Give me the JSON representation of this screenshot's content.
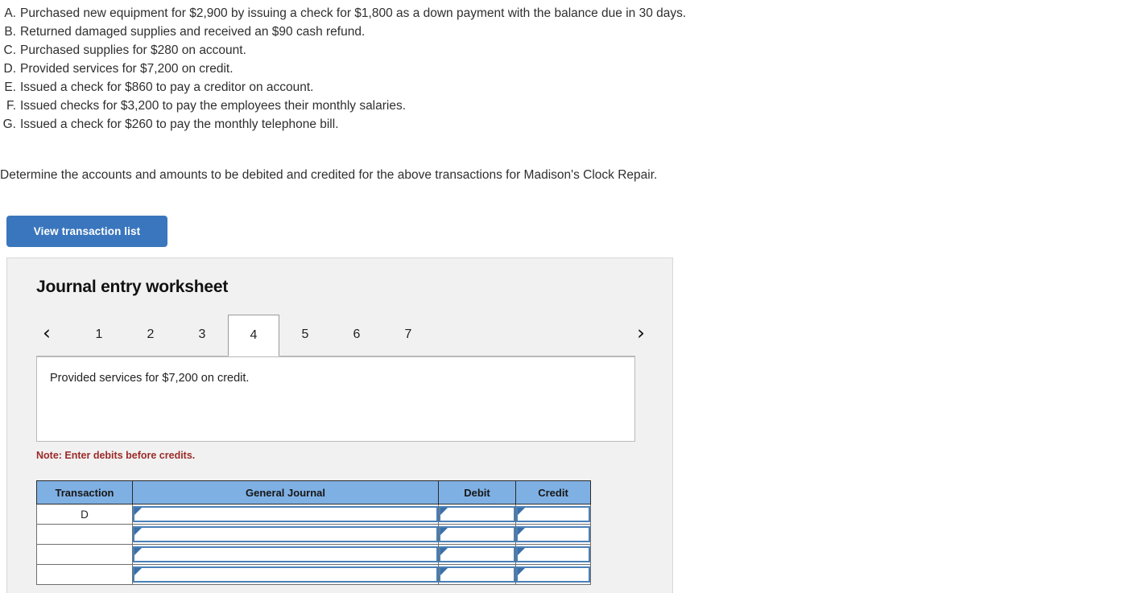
{
  "transactions": [
    {
      "letter": "A.",
      "text": "Purchased new equipment for $2,900 by issuing a check for $1,800 as a down payment with the balance due in 30 days."
    },
    {
      "letter": "B.",
      "text": "Returned damaged supplies and received an $90 cash refund."
    },
    {
      "letter": "C.",
      "text": "Purchased supplies for $280 on account."
    },
    {
      "letter": "D.",
      "text": "Provided services for $7,200 on credit."
    },
    {
      "letter": "E.",
      "text": "Issued a check for $860 to pay a creditor on account."
    },
    {
      "letter": "F.",
      "text": "Issued checks for $3,200 to pay the employees their monthly salaries."
    },
    {
      "letter": "G.",
      "text": "Issued a check for $260 to pay the monthly telephone bill."
    }
  ],
  "prompt": "Determine the accounts and amounts to be debited and credited for the above transactions for Madison's Clock Repair.",
  "view_button_label": "View transaction list",
  "worksheet": {
    "title": "Journal entry worksheet",
    "prev_arrow": "‹",
    "next_arrow": "›",
    "tabs": [
      {
        "label": "1",
        "active": false
      },
      {
        "label": "2",
        "active": false
      },
      {
        "label": "3",
        "active": false
      },
      {
        "label": "4",
        "active": true
      },
      {
        "label": "5",
        "active": false
      },
      {
        "label": "6",
        "active": false
      },
      {
        "label": "7",
        "active": false
      }
    ],
    "description": "Provided services for $7,200 on credit.",
    "note": "Note: Enter debits before credits.",
    "table": {
      "headers": [
        "Transaction",
        "General Journal",
        "Debit",
        "Credit"
      ],
      "rows": [
        {
          "transaction": "D",
          "general_journal": "",
          "debit": "",
          "credit": ""
        },
        {
          "transaction": "",
          "general_journal": "",
          "debit": "",
          "credit": ""
        },
        {
          "transaction": "",
          "general_journal": "",
          "debit": "",
          "credit": ""
        },
        {
          "transaction": "",
          "general_journal": "",
          "debit": "",
          "credit": ""
        }
      ]
    }
  },
  "colors": {
    "button_blue": "#3a76bd",
    "table_header_blue": "#7fb0e3",
    "field_border_blue": "#4a80b8",
    "note_red": "#9c2a2a",
    "panel_gray": "#f1f1f1"
  }
}
